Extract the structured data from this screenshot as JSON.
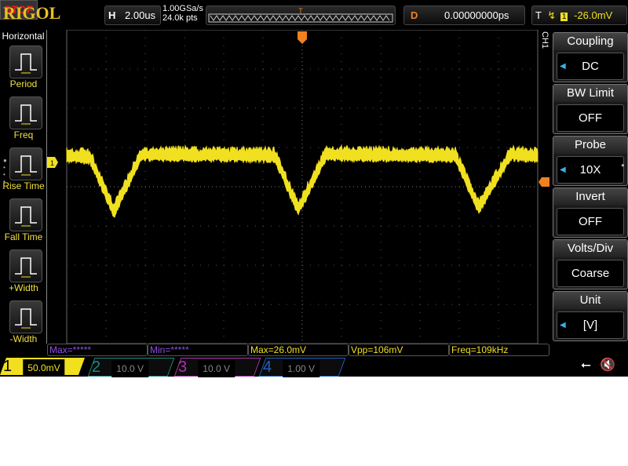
{
  "header": {
    "logo": "RIGOL",
    "run_state": "STOP",
    "timebase_label": "H",
    "timebase": "2.00us",
    "sample_rate": "1.00GSa/s",
    "memory_depth": "24.0k pts",
    "delay_label": "D",
    "delay": "0.00000000ps",
    "trigger_label": "T",
    "trigger_source": "1",
    "trigger_level": "-26.0mV"
  },
  "left_menu": {
    "title": "Horizontal",
    "items": [
      {
        "label": "Period",
        "icon": "period-icon"
      },
      {
        "label": "Freq",
        "icon": "freq-icon"
      },
      {
        "label": "Rise Time",
        "icon": "rise-time-icon"
      },
      {
        "label": "Fall Time",
        "icon": "fall-time-icon"
      },
      {
        "label": "+Width",
        "icon": "positive-width-icon"
      },
      {
        "label": "-Width",
        "icon": "negative-width-icon"
      }
    ]
  },
  "right_menu": {
    "channel": "CH1",
    "items": [
      {
        "title": "Coupling",
        "value": "DC",
        "arrow": true
      },
      {
        "title": "BW Limit",
        "value": "OFF",
        "arrow": false
      },
      {
        "title": "Probe",
        "value": "10X",
        "arrow": true
      },
      {
        "title": "Invert",
        "value": "OFF",
        "arrow": false
      },
      {
        "title": "Volts/Div",
        "value": "Coarse",
        "arrow": false
      },
      {
        "title": "Unit",
        "value": "[V]",
        "arrow": true
      }
    ]
  },
  "measurements": [
    "Max=*****",
    "Min=*****",
    "Max=26.0mV",
    "Vpp=106mV",
    "Freq=109kHz"
  ],
  "channels": [
    {
      "num": "1",
      "scale": "50.0mV",
      "color": "#f0e020",
      "active": true
    },
    {
      "num": "2",
      "scale": "10.0 V",
      "color": "#1a8a80"
    },
    {
      "num": "3",
      "scale": "10.0 V",
      "color": "#b030b0"
    },
    {
      "num": "4",
      "scale": "1.00 V",
      "color": "#2060c0"
    }
  ],
  "chart_data": {
    "type": "line",
    "xlabel": "",
    "ylabel": "",
    "x_units": "us",
    "y_units": "mV",
    "xlim": [
      -12,
      12
    ],
    "ylim": [
      -200,
      200
    ],
    "grid": true,
    "series": [
      {
        "name": "1",
        "color": "#f0e020",
        "x": [
          -12,
          -10.8,
          -9.6,
          -8.2,
          -1.4,
          -0.2,
          1.2,
          7.8,
          9,
          10.6,
          12
        ],
        "y": [
          8,
          6,
          -63,
          10,
          8,
          -60,
          10,
          8,
          -58,
          10,
          8
        ]
      }
    ]
  }
}
